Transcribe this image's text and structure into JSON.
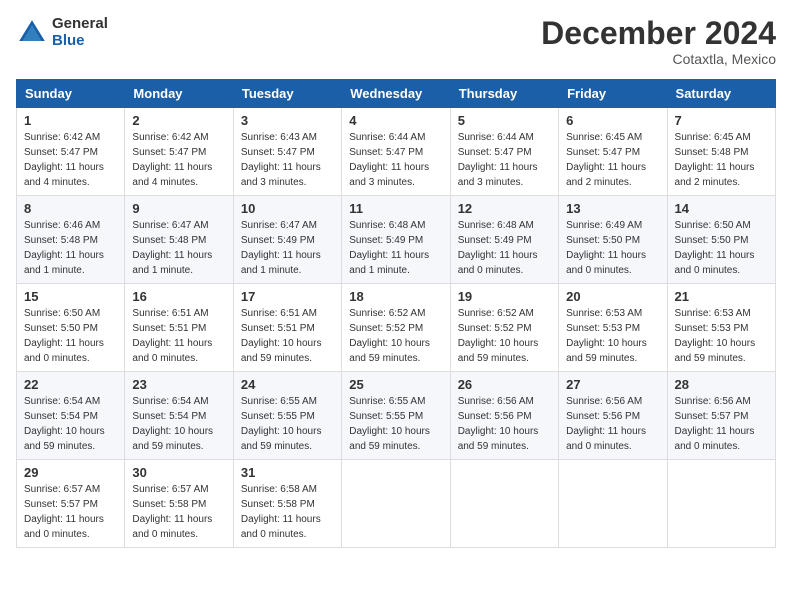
{
  "header": {
    "logo_general": "General",
    "logo_blue": "Blue",
    "month_title": "December 2024",
    "location": "Cotaxtla, Mexico"
  },
  "days_of_week": [
    "Sunday",
    "Monday",
    "Tuesday",
    "Wednesday",
    "Thursday",
    "Friday",
    "Saturday"
  ],
  "weeks": [
    [
      {
        "day": "1",
        "sunrise": "6:42 AM",
        "sunset": "5:47 PM",
        "daylight": "11 hours and 4 minutes."
      },
      {
        "day": "2",
        "sunrise": "6:42 AM",
        "sunset": "5:47 PM",
        "daylight": "11 hours and 4 minutes."
      },
      {
        "day": "3",
        "sunrise": "6:43 AM",
        "sunset": "5:47 PM",
        "daylight": "11 hours and 3 minutes."
      },
      {
        "day": "4",
        "sunrise": "6:44 AM",
        "sunset": "5:47 PM",
        "daylight": "11 hours and 3 minutes."
      },
      {
        "day": "5",
        "sunrise": "6:44 AM",
        "sunset": "5:47 PM",
        "daylight": "11 hours and 3 minutes."
      },
      {
        "day": "6",
        "sunrise": "6:45 AM",
        "sunset": "5:47 PM",
        "daylight": "11 hours and 2 minutes."
      },
      {
        "day": "7",
        "sunrise": "6:45 AM",
        "sunset": "5:48 PM",
        "daylight": "11 hours and 2 minutes."
      }
    ],
    [
      {
        "day": "8",
        "sunrise": "6:46 AM",
        "sunset": "5:48 PM",
        "daylight": "11 hours and 1 minute."
      },
      {
        "day": "9",
        "sunrise": "6:47 AM",
        "sunset": "5:48 PM",
        "daylight": "11 hours and 1 minute."
      },
      {
        "day": "10",
        "sunrise": "6:47 AM",
        "sunset": "5:49 PM",
        "daylight": "11 hours and 1 minute."
      },
      {
        "day": "11",
        "sunrise": "6:48 AM",
        "sunset": "5:49 PM",
        "daylight": "11 hours and 1 minute."
      },
      {
        "day": "12",
        "sunrise": "6:48 AM",
        "sunset": "5:49 PM",
        "daylight": "11 hours and 0 minutes."
      },
      {
        "day": "13",
        "sunrise": "6:49 AM",
        "sunset": "5:50 PM",
        "daylight": "11 hours and 0 minutes."
      },
      {
        "day": "14",
        "sunrise": "6:50 AM",
        "sunset": "5:50 PM",
        "daylight": "11 hours and 0 minutes."
      }
    ],
    [
      {
        "day": "15",
        "sunrise": "6:50 AM",
        "sunset": "5:50 PM",
        "daylight": "11 hours and 0 minutes."
      },
      {
        "day": "16",
        "sunrise": "6:51 AM",
        "sunset": "5:51 PM",
        "daylight": "11 hours and 0 minutes."
      },
      {
        "day": "17",
        "sunrise": "6:51 AM",
        "sunset": "5:51 PM",
        "daylight": "10 hours and 59 minutes."
      },
      {
        "day": "18",
        "sunrise": "6:52 AM",
        "sunset": "5:52 PM",
        "daylight": "10 hours and 59 minutes."
      },
      {
        "day": "19",
        "sunrise": "6:52 AM",
        "sunset": "5:52 PM",
        "daylight": "10 hours and 59 minutes."
      },
      {
        "day": "20",
        "sunrise": "6:53 AM",
        "sunset": "5:53 PM",
        "daylight": "10 hours and 59 minutes."
      },
      {
        "day": "21",
        "sunrise": "6:53 AM",
        "sunset": "5:53 PM",
        "daylight": "10 hours and 59 minutes."
      }
    ],
    [
      {
        "day": "22",
        "sunrise": "6:54 AM",
        "sunset": "5:54 PM",
        "daylight": "10 hours and 59 minutes."
      },
      {
        "day": "23",
        "sunrise": "6:54 AM",
        "sunset": "5:54 PM",
        "daylight": "10 hours and 59 minutes."
      },
      {
        "day": "24",
        "sunrise": "6:55 AM",
        "sunset": "5:55 PM",
        "daylight": "10 hours and 59 minutes."
      },
      {
        "day": "25",
        "sunrise": "6:55 AM",
        "sunset": "5:55 PM",
        "daylight": "10 hours and 59 minutes."
      },
      {
        "day": "26",
        "sunrise": "6:56 AM",
        "sunset": "5:56 PM",
        "daylight": "10 hours and 59 minutes."
      },
      {
        "day": "27",
        "sunrise": "6:56 AM",
        "sunset": "5:56 PM",
        "daylight": "11 hours and 0 minutes."
      },
      {
        "day": "28",
        "sunrise": "6:56 AM",
        "sunset": "5:57 PM",
        "daylight": "11 hours and 0 minutes."
      }
    ],
    [
      {
        "day": "29",
        "sunrise": "6:57 AM",
        "sunset": "5:57 PM",
        "daylight": "11 hours and 0 minutes."
      },
      {
        "day": "30",
        "sunrise": "6:57 AM",
        "sunset": "5:58 PM",
        "daylight": "11 hours and 0 minutes."
      },
      {
        "day": "31",
        "sunrise": "6:58 AM",
        "sunset": "5:58 PM",
        "daylight": "11 hours and 0 minutes."
      },
      null,
      null,
      null,
      null
    ]
  ],
  "labels": {
    "sunrise_prefix": "Sunrise: ",
    "sunset_prefix": "Sunset: ",
    "daylight_prefix": "Daylight: "
  }
}
